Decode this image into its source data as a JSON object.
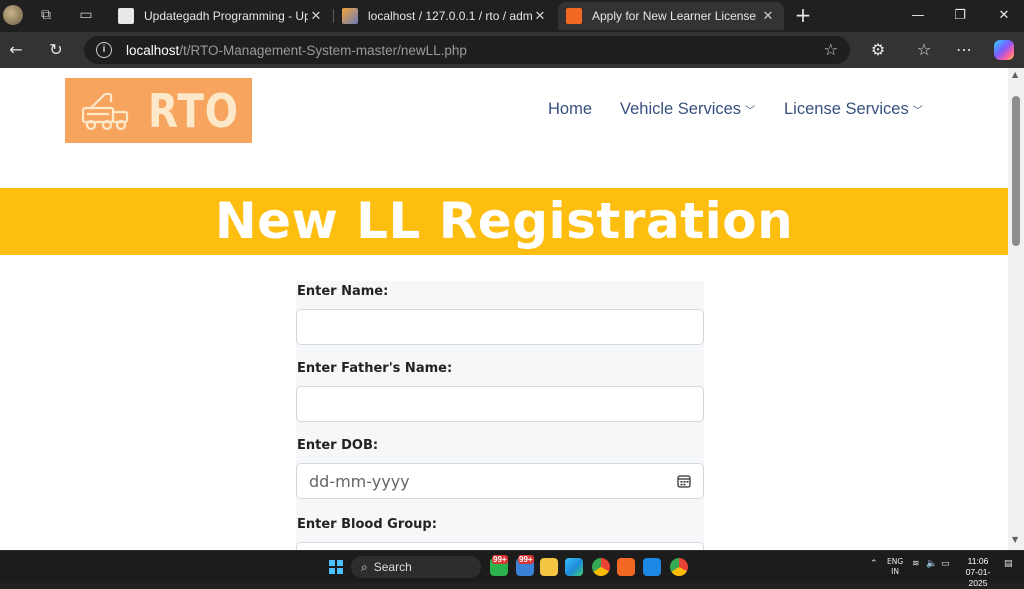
{
  "browser": {
    "tabs": [
      {
        "title": "Updategadh Programming - Upd",
        "active": false
      },
      {
        "title": "localhost / 127.0.0.1 / rto / admin",
        "active": false
      },
      {
        "title": "Apply for New Learner License",
        "active": true
      }
    ],
    "url_host": "localhost",
    "url_path": "/t/RTO-Management-System-master/newLL.php"
  },
  "site": {
    "logo_text": "RTO",
    "nav": [
      {
        "label": "Home",
        "has_dropdown": false
      },
      {
        "label": "Vehicle Services",
        "has_dropdown": true
      },
      {
        "label": "License Services",
        "has_dropdown": true
      }
    ],
    "banner_title": "New LL Registration",
    "colors": {
      "banner": "#fdbe10",
      "logo_bg": "#f7a55e",
      "nav_text": "#37517e"
    }
  },
  "form": {
    "name_label": "Enter Name:",
    "name_value": "",
    "father_label": "Enter Father's Name:",
    "father_value": "",
    "dob_label": "Enter DOB:",
    "dob_placeholder": "dd-mm-yyyy",
    "blood_label": "Enter Blood Group:"
  },
  "taskbar": {
    "search_label": "Search",
    "badge_1": "99+",
    "badge_2": "99+",
    "lang_top": "ENG",
    "lang_bottom": "IN",
    "time": "11:06",
    "date": "07-01-2025"
  }
}
